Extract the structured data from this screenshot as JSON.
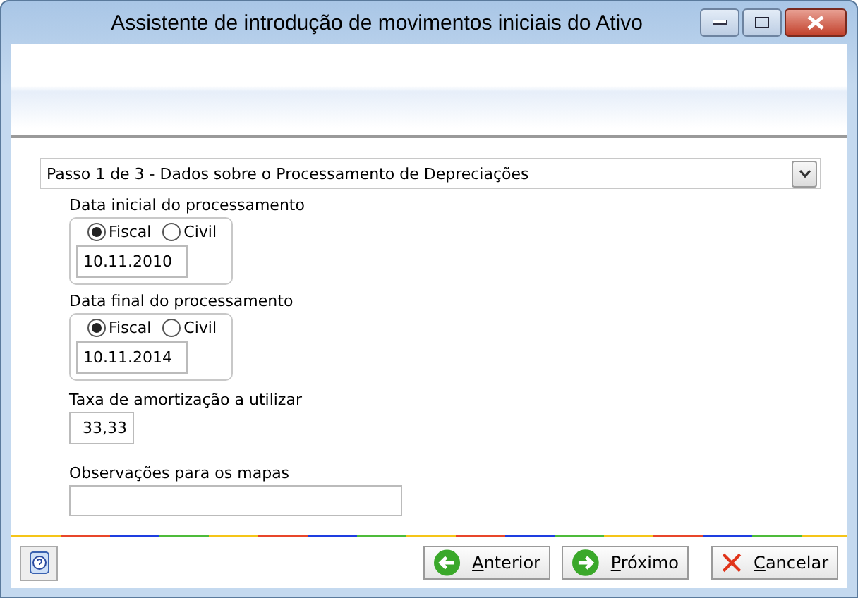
{
  "window": {
    "title": "Assistente de introdução de movimentos iniciais do Ativo"
  },
  "step_dropdown": {
    "value": "Passo 1 de 3 - Dados sobre o Processamento de Depreciações"
  },
  "date_groups": [
    {
      "label": "Data inicial do processamento",
      "options": [
        {
          "label": "Fiscal",
          "selected": true
        },
        {
          "label": "Civil",
          "selected": false
        }
      ],
      "value": "10.11.2010"
    },
    {
      "label": "Data final do processamento",
      "options": [
        {
          "label": "Fiscal",
          "selected": true
        },
        {
          "label": "Civil",
          "selected": false
        }
      ],
      "value": "10.11.2014"
    }
  ],
  "rate": {
    "label": "Taxa de amortização a utilizar",
    "value": "33,33"
  },
  "notes": {
    "label": "Observações para os mapas"
  },
  "buttons": [
    {
      "kind": "back",
      "label": "Anterior"
    },
    {
      "kind": "next",
      "label": "Próximo"
    },
    {
      "kind": "cancel",
      "label": "Cancelar"
    }
  ]
}
